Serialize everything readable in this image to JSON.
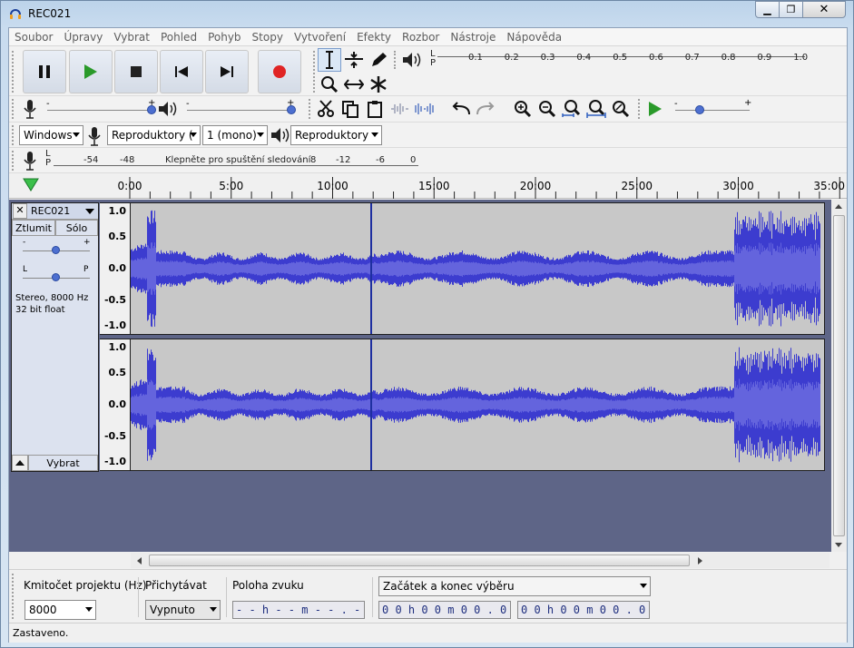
{
  "window": {
    "title": "REC021",
    "minimize_label": "▭",
    "maximize_label": "□",
    "close_label": "✕"
  },
  "menu": [
    "Soubor",
    "Úpravy",
    "Vybrat",
    "Pohled",
    "Pohyb",
    "Stopy",
    "Vytvoření",
    "Efekty",
    "Rozbor",
    "Nástroje",
    "Nápověda"
  ],
  "meters": {
    "playback_lr": "L\nP",
    "playback_scale": [
      "0.1",
      "0.2",
      "0.3",
      "0.4",
      "0.5",
      "0.6",
      "0.7",
      "0.8",
      "0.9",
      "1.0"
    ],
    "record_scale": [
      "-54",
      "-48",
      "-12",
      "-6",
      "0"
    ],
    "record_prompt": "Klepněte pro spuštění sledování",
    "record_prompt_after": "8",
    "l_label": "L",
    "p_label": "P"
  },
  "device_toolbar": {
    "host": "Windows",
    "recording_device": "Reproduktory (",
    "channels": "1 (mono)",
    "playback_device": "Reproduktory"
  },
  "timeline": {
    "ticks": [
      "0:00",
      "5:00",
      "10:00",
      "15:00",
      "20:00",
      "25:00",
      "30:00",
      "35:00"
    ]
  },
  "track": {
    "name": "REC021",
    "mute_label": "Ztlumit",
    "solo_label": "Sólo",
    "info_line1": "Stereo, 8000 Hz",
    "info_line2": "32 bit float",
    "select_label": "Vybrat",
    "pan_l": "L",
    "pan_p": "P",
    "gain_minus": "-",
    "gain_plus": "+",
    "y_labels": [
      "1.0",
      "0.5",
      "0.0",
      "-0.5",
      "-1.0"
    ]
  },
  "selection_toolbar": {
    "rate_label": "Kmitočet projektu (Hz)",
    "rate_value": "8000",
    "snap_label": "Přichytávat",
    "snap_value": "Vypnuto",
    "audio_position_label": "Poloha zvuku",
    "audio_position_value": "- - h - - m - - . - - - s",
    "selection_mode": "Začátek a konec výběru",
    "sel_start": "0 0 h 0 0 m 0 0 . 0 0 0 s",
    "sel_end": "0 0 h 0 0 m 0 0 . 0 0 0 s"
  },
  "status": {
    "text": "Zastaveno."
  },
  "colors": {
    "waveform": "#3c3ccf",
    "waveform_rms": "#6464dd",
    "track_bg": "#5e6587",
    "record": "#e02424",
    "play": "#2a9a2a"
  }
}
